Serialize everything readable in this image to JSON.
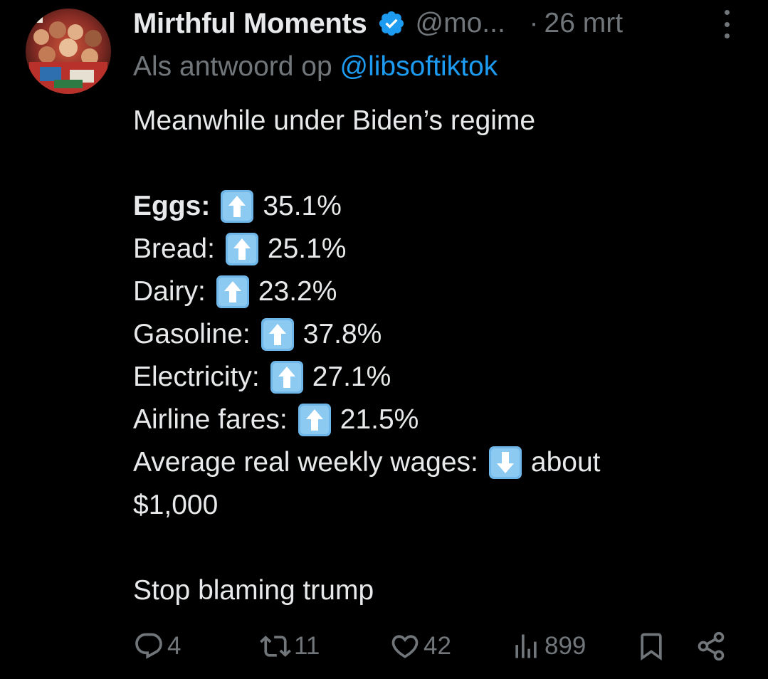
{
  "tweet": {
    "author": {
      "display_name": "Mirthful Moments",
      "handle": "@mo...",
      "verified_color": "#1d9bf0"
    },
    "separator": "·",
    "date": "26 mrt",
    "reply_prefix": "Als antwoord op",
    "reply_mention": "@libsoftiktok",
    "intro": "Meanwhile under Biden’s regime",
    "items": [
      {
        "label": "Eggs:",
        "arrow": "up",
        "value": "35.1%"
      },
      {
        "label": "Bread:",
        "arrow": "up",
        "value": "25.1%"
      },
      {
        "label": "Dairy:",
        "arrow": "up",
        "value": "23.2%"
      },
      {
        "label": "Gasoline:",
        "arrow": "up",
        "value": "37.8%"
      },
      {
        "label": "Electricity:",
        "arrow": "up",
        "value": "27.1%"
      },
      {
        "label": "Airline fares:",
        "arrow": "up",
        "value": "21.5%"
      },
      {
        "label": "Average real weekly wages:",
        "arrow": "down",
        "value": "about"
      }
    ],
    "wage_continuation": "$1,000",
    "closing": "Stop blaming trump"
  },
  "actions": {
    "replies": "4",
    "reposts": "11",
    "likes": "42",
    "views": "899"
  },
  "icons": {
    "reply": "reply-icon",
    "repost": "repost-icon",
    "like": "heart-icon",
    "views": "views-chart-icon",
    "bookmark": "bookmark-icon",
    "share": "share-icon",
    "more": "more-dots-icon",
    "verified": "verified-badge-icon",
    "arrow_up": "arrow-up-emoji-icon",
    "arrow_down": "arrow-down-emoji-icon"
  },
  "colors": {
    "background": "#000000",
    "text_primary": "#e7e9ea",
    "text_secondary": "#71767b",
    "accent": "#1d9bf0",
    "emoji_box": "#6fb7e8"
  }
}
